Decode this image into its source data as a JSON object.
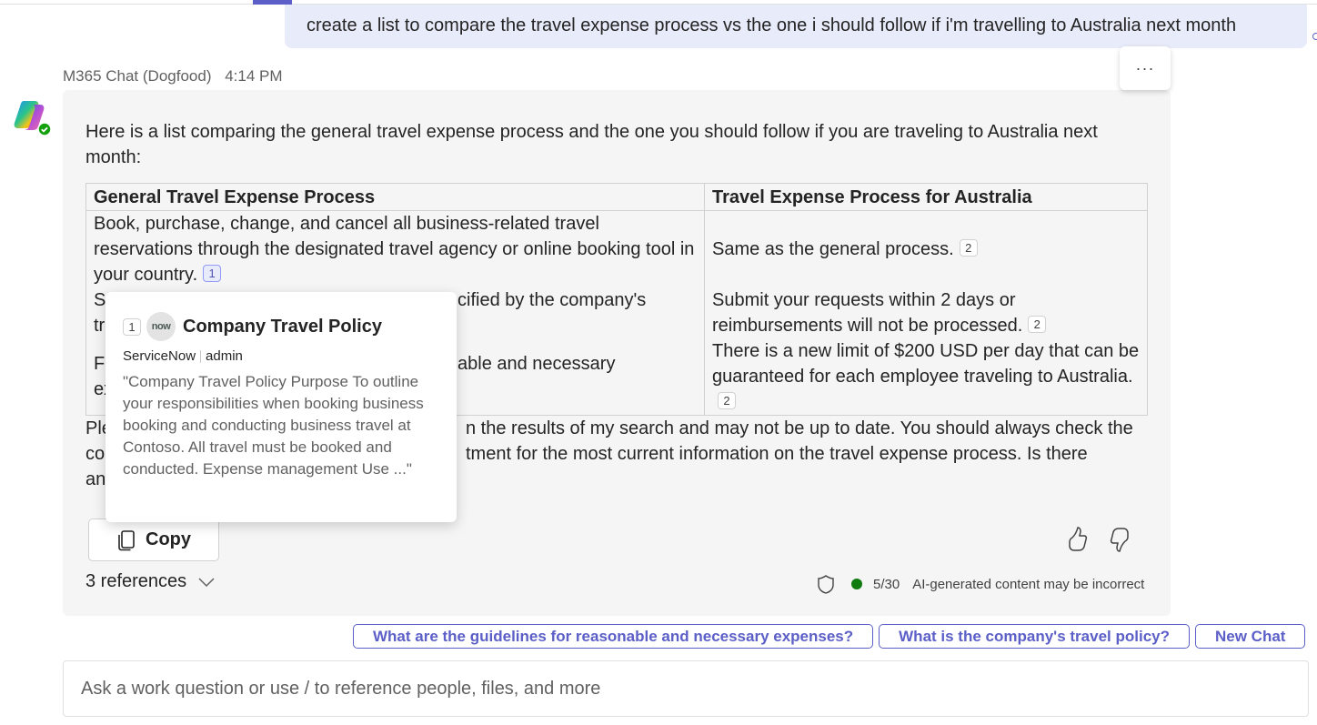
{
  "user_message": {
    "text": "create a list to compare the travel expense process vs the one i should follow if i'm travelling to Australia next month"
  },
  "bot_message": {
    "sender": "M365 Chat (Dogfood)",
    "time": "4:14 PM",
    "more_options_label": "···",
    "intro": "Here is a list comparing the general travel expense process and the one you should follow if you are traveling to Australia next month:",
    "table": {
      "headers": [
        "General Travel Expense Process",
        "Travel Expense Process for Australia"
      ],
      "rows": [
        {
          "general": "Book, purchase, change, and cancel all business-related travel reservations through the designated travel agency or online booking tool in your country.",
          "general_cite": "1",
          "australia": "Same as the general process.",
          "australia_cite": "2"
        },
        {
          "general": "Submit your expense reports within the deadline specified by the company's travel policy.",
          "general_visible_left": "Su",
          "general_visible_left_line2": "tr",
          "general_visible_right": "cified by the company's",
          "australia": "Submit your requests within 2 days or reimbursements will not be processed.",
          "australia_cite": "2"
        },
        {
          "general_visible_left": "Fo",
          "general_visible_left_line2": "ex",
          "general_visible_right": "able and necessary",
          "australia": "There is a new limit of $200 USD per day that can be guaranteed for each employee traveling to Australia.",
          "australia_cite": "2"
        }
      ]
    },
    "disclaimer_visible": {
      "line1_left": "Ple",
      "line1_right": "n the results of my search and may not be up to date. You should always check the",
      "line2_left": "co",
      "line2_right": "tment for the most current information on the travel expense process. Is there",
      "line3_left": "an"
    },
    "copy_label": "Copy",
    "references_label": "3 references",
    "message_count": "5/30",
    "ai_notice": "AI-generated content may be incorrect"
  },
  "citation_popup": {
    "index": "1",
    "source_logo": "now",
    "title": "Company Travel Policy",
    "source": "ServiceNow",
    "author": "admin",
    "snippet": "\"Company Travel Policy Purpose To outline your responsibilities when booking business booking and conducting business travel at Contoso. All travel must be booked and conducted. Expense management Use ...\""
  },
  "suggestions": [
    "What are the guidelines for reasonable and necessary expenses?",
    "What is the company's travel policy?",
    "New Chat"
  ],
  "compose": {
    "placeholder": "Ask a work question or use / to reference people, files, and more",
    "value": ""
  },
  "colors": {
    "accent": "#5b5fc7",
    "user_bubble": "#e8ebfa",
    "bot_card": "#f5f5f5",
    "status_green": "#107c10"
  }
}
